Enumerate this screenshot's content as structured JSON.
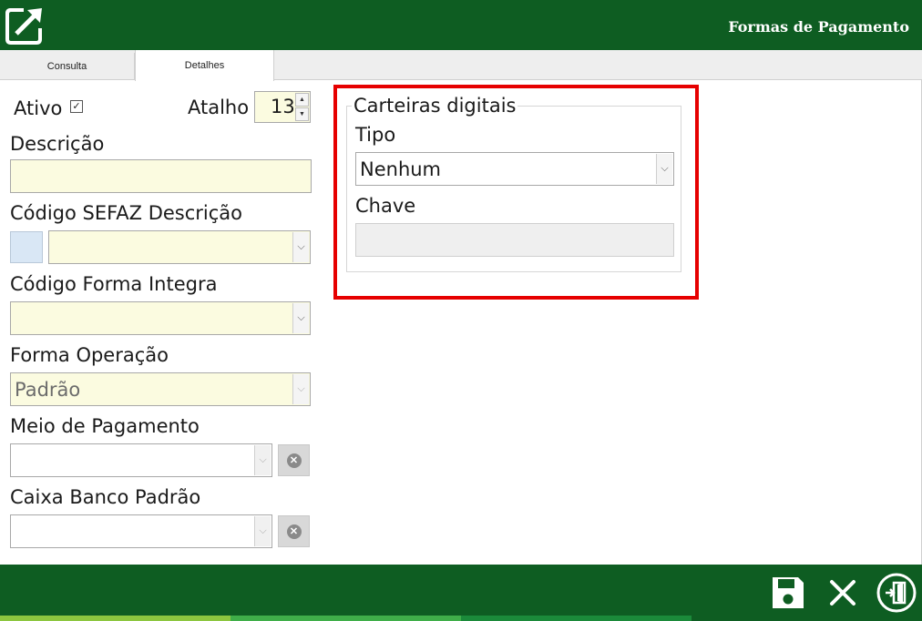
{
  "header": {
    "title": "Formas de Pagamento"
  },
  "tabs": [
    {
      "label": "Consulta"
    },
    {
      "label": "Detalhes"
    }
  ],
  "form": {
    "ativo_label": "Ativo",
    "ativo_checked": true,
    "atalho_label": "Atalho",
    "atalho_value": "13",
    "descricao_label": "Descrição",
    "descricao_value": "",
    "codigo_sefaz_label": "Código SEFAZ Descrição",
    "codigo_sefaz_value": "",
    "codigo_integra_label": "Código Forma Integra",
    "codigo_integra_value": "",
    "forma_operacao_label": "Forma Operação",
    "forma_operacao_value": "Padrão",
    "meio_pagamento_label": "Meio de Pagamento",
    "meio_pagamento_value": "",
    "caixa_banco_label": "Caixa Banco Padrão",
    "caixa_banco_value": ""
  },
  "carteiras": {
    "title": "Carteiras digitais",
    "tipo_label": "Tipo",
    "tipo_value": "Nenhum",
    "chave_label": "Chave",
    "chave_value": ""
  },
  "icons": {
    "logo": "logo-arrow-icon",
    "save": "save-icon",
    "close": "close-icon",
    "exit": "exit-door-icon"
  },
  "colors": {
    "brand_green": "#0e5d22",
    "field_yellow": "#fbfbe0",
    "highlight_red": "#e60000"
  }
}
